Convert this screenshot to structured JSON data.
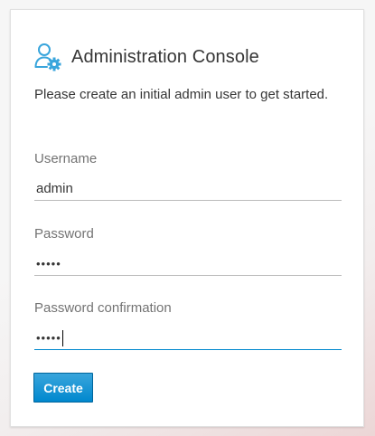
{
  "header": {
    "title": "Administration Console",
    "icon": "users-cog-icon"
  },
  "intro": "Please create an initial admin user to get started.",
  "form": {
    "username": {
      "label": "Username",
      "value": "admin"
    },
    "password": {
      "label": "Password",
      "masked_value": "•••••"
    },
    "password_confirmation": {
      "label": "Password confirmation",
      "masked_value": "•••••"
    },
    "submit_label": "Create"
  },
  "colors": {
    "accent": "#0088ce",
    "button_top": "#39a5dc",
    "icon": "#39a5dc",
    "text": "#363636",
    "label": "#737373"
  }
}
